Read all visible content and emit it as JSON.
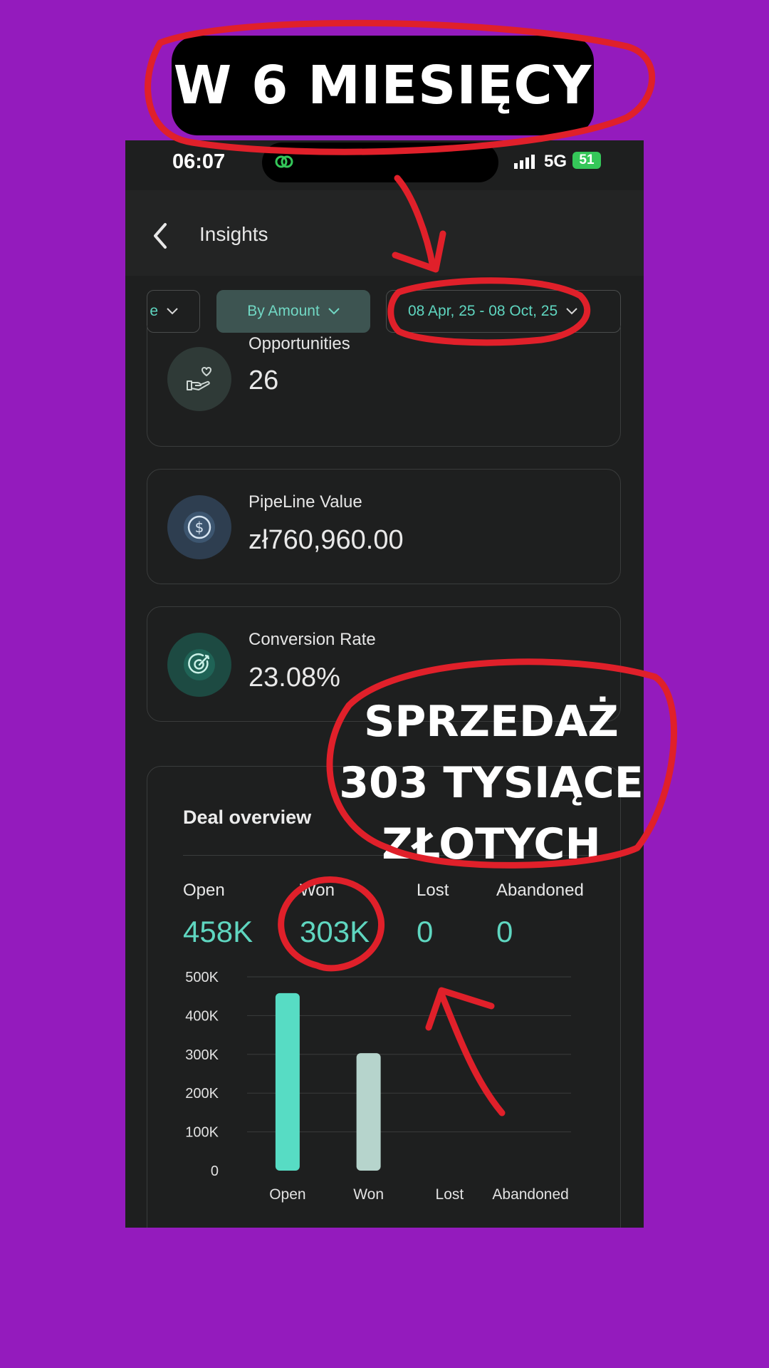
{
  "banner": {
    "text": "W 6 MIESIĘCY"
  },
  "status_bar": {
    "time": "06:07",
    "network": "5G",
    "battery": "51"
  },
  "header": {
    "title": "Insights",
    "back_icon": "chevron-left-icon"
  },
  "filters": {
    "first": "e",
    "amount": "By Amount",
    "date_range": "08 Apr, 25 - 08 Oct, 25"
  },
  "metrics": {
    "opportunities": {
      "label": "Opportunities",
      "value": "26",
      "icon": "hand-heart-icon"
    },
    "pipeline": {
      "label": "PipeLine Value",
      "value": "zł760,960.00",
      "icon": "dollar-coin-icon"
    },
    "conversion": {
      "label": "Conversion Rate",
      "value": "23.08%",
      "icon": "target-icon"
    }
  },
  "deal_overview": {
    "title": "Deal overview",
    "stats": [
      {
        "label": "Open",
        "value": "458K"
      },
      {
        "label": "Won",
        "value": "303K"
      },
      {
        "label": "Lost",
        "value": "0"
      },
      {
        "label": "Abandoned",
        "value": "0"
      }
    ]
  },
  "overlay": {
    "line1": "SPRZEDAŻ",
    "line2": "303 TYSIĄCE",
    "line3": "ZŁOTYCH"
  },
  "colors": {
    "background": "#941bbd",
    "accent": "#5fd6c0",
    "won_bar": "#b6d4cc",
    "annotation": "#e0202a"
  },
  "chart_data": {
    "type": "bar",
    "categories": [
      "Open",
      "Won",
      "Lost",
      "Abandoned"
    ],
    "values": [
      458000,
      303000,
      0,
      0
    ],
    "y_ticks": [
      "0",
      "100K",
      "200K",
      "300K",
      "400K",
      "500K"
    ],
    "ylim": [
      0,
      500000
    ],
    "grid": true
  }
}
